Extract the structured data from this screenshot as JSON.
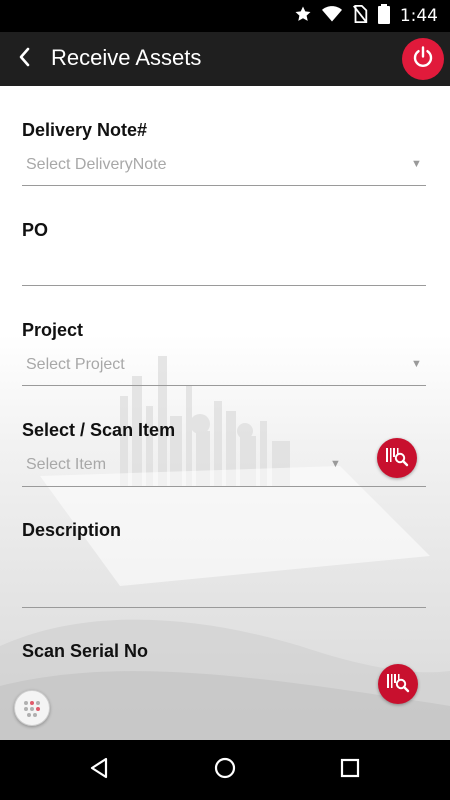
{
  "status_bar": {
    "time": "1:44",
    "icons": [
      "star-icon",
      "wifi-icon",
      "no-sim-icon",
      "battery-icon"
    ]
  },
  "app_bar": {
    "title": "Receive Assets",
    "back_icon": "chevron-left-icon",
    "power_icon": "power-icon"
  },
  "form": {
    "delivery_note": {
      "label": "Delivery Note#",
      "placeholder": "Select DeliveryNote"
    },
    "po": {
      "label": "PO",
      "value": ""
    },
    "project": {
      "label": "Project",
      "placeholder": "Select Project"
    },
    "item": {
      "label": "Select / Scan Item",
      "placeholder": "Select Item",
      "scan_icon": "barcode-search-icon"
    },
    "description": {
      "label": "Description",
      "value": ""
    },
    "serial": {
      "label": "Scan Serial No",
      "scan_icon": "barcode-search-icon"
    }
  },
  "nav_bar": {
    "back_icon": "triangle-back-icon",
    "home_icon": "circle-home-icon",
    "recents_icon": "square-recents-icon"
  },
  "colors": {
    "app_bar": "#1f1f1f",
    "accent_red": "#e11a3b",
    "scan_red": "#c8102e",
    "label": "#111111",
    "placeholder": "#a8a8a8"
  }
}
